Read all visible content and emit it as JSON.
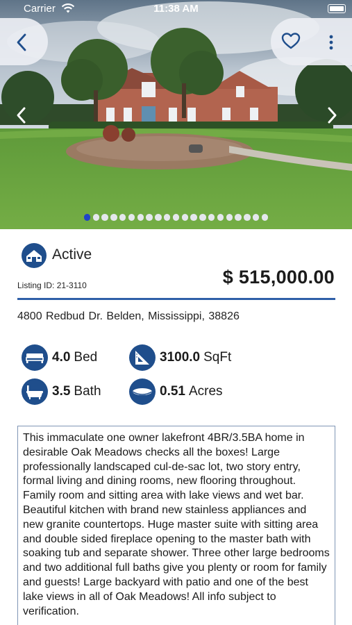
{
  "status_bar": {
    "carrier": "Carrier",
    "time": "11:38 AM"
  },
  "navigation": {
    "back_icon": "chevron-left-icon",
    "favorite_icon": "heart-outline-icon",
    "more_icon": "more-vertical-icon"
  },
  "gallery": {
    "photo": "house-exterior-front",
    "photo_count": 21,
    "current_index": 1,
    "prev_icon": "chevron-left-icon",
    "next_icon": "chevron-right-icon"
  },
  "listing": {
    "status": "Active",
    "status_icon": "house-badge-icon",
    "listing_id": "Listing ID: 21-3110",
    "price": "$ 515,000.00",
    "address": "4800  Redbud Dr. Belden, Mississippi, 38826"
  },
  "features": {
    "bed": {
      "value": "4.0",
      "unit": "Bed",
      "icon": "bed-icon"
    },
    "sqft": {
      "value": "3100.0",
      "unit": "SqFt",
      "icon": "set-square-icon"
    },
    "bath": {
      "value": "3.5",
      "unit": "Bath",
      "icon": "bathtub-icon"
    },
    "acres": {
      "value": "0.51",
      "unit": "Acres",
      "icon": "land-icon"
    }
  },
  "description": "This immaculate one owner lakefront 4BR/3.5BA home in desirable Oak Meadows checks all the boxes! Large professionally landscaped cul-de-sac lot, two story entry, formal living and dining rooms, new flooring throughout. Family room and sitting area with lake views and wet bar. Beautiful kitchen with brand new stainless appliances and new granite countertops. Huge master suite with sitting area and double sided fireplace opening to the master bath with soaking tub and separate shower. Three other large bedrooms and two additional full baths give you plenty or room for family and guests! Large backyard with patio and one of the best lake views in all of Oak Meadows! All info subject to verification.",
  "colors": {
    "accent": "#2f5fa8",
    "icon_blue": "#1f4e8c",
    "active_dot": "#1f43c9",
    "inactive_dot": "#e4e7ec",
    "border": "#7f95b5"
  }
}
